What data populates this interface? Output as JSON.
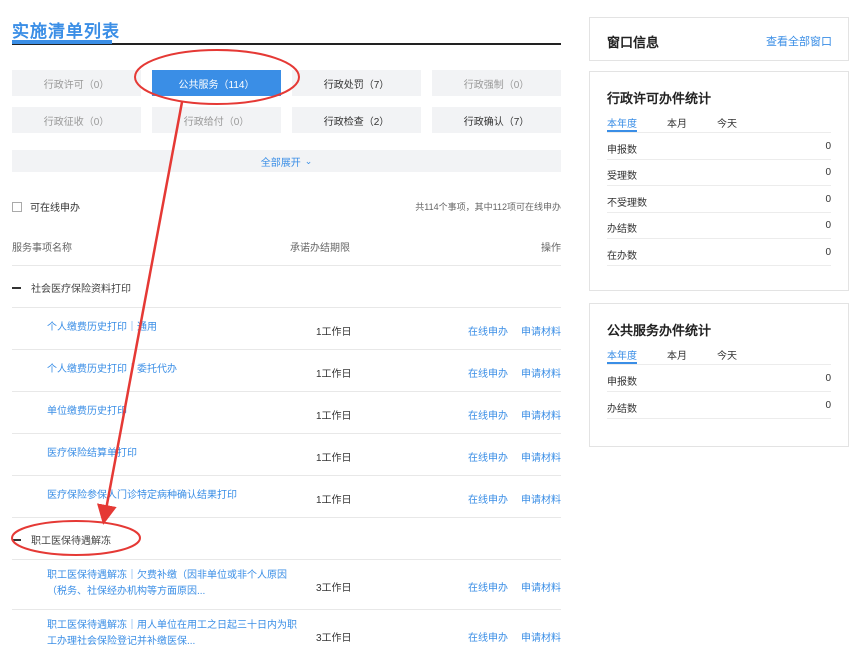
{
  "page_title": "实施清单列表",
  "categories": [
    {
      "label": "行政许可（0）"
    },
    {
      "label": "公共服务（114）"
    },
    {
      "label": "行政处罚（7）"
    },
    {
      "label": "行政强制（0）"
    },
    {
      "label": "行政征收（0）"
    },
    {
      "label": "行政给付（0）"
    },
    {
      "label": "行政检查（2）"
    },
    {
      "label": "行政确认（7）"
    }
  ],
  "expand_all": "全部展开",
  "online_filter_label": "可在线申办",
  "summary_text": "共114个事项，其中112项可在线申办",
  "table_headers": {
    "name": "服务事项名称",
    "deadline": "承诺办结期限",
    "operation": "操作"
  },
  "groups": [
    {
      "title": "社会医疗保险资料打印",
      "items": [
        {
          "name": "个人缴费历史打印｜通用",
          "days": "1工作日",
          "online": "在线申办",
          "materials": "申请材料"
        },
        {
          "name": "个人缴费历史打印｜委托代办",
          "days": "1工作日",
          "online": "在线申办",
          "materials": "申请材料"
        },
        {
          "name": "单位缴费历史打印",
          "days": "1工作日",
          "online": "在线申办",
          "materials": "申请材料"
        },
        {
          "name": "医疗保险结算单打印",
          "days": "1工作日",
          "online": "在线申办",
          "materials": "申请材料"
        },
        {
          "name": "医疗保险参保人门诊特定病种确认结果打印",
          "days": "1工作日",
          "online": "在线申办",
          "materials": "申请材料"
        }
      ]
    },
    {
      "title": "职工医保待遇解冻",
      "items": [
        {
          "name_line1": "职工医保待遇解冻｜欠费补缴（因非单位或非个人原因",
          "name_line2": "（税务、社保经办机构等方面原因...",
          "days": "3工作日",
          "online": "在线申办",
          "materials": "申请材料"
        },
        {
          "name_line1": "职工医保待遇解冻｜用人单位在用工之日起三十日内为职",
          "name_line2": "工办理社会保险登记并补缴医保...",
          "days": "3工作日",
          "online": "在线申办",
          "materials": "申请材料"
        }
      ]
    }
  ],
  "window_panel": {
    "title": "窗口信息",
    "link": "查看全部窗口"
  },
  "license_stats": {
    "title": "行政许可办件统计",
    "tabs": [
      "本年度",
      "本月",
      "今天"
    ],
    "rows": [
      {
        "label": "申报数",
        "value": "0"
      },
      {
        "label": "受理数",
        "value": "0"
      },
      {
        "label": "不受理数",
        "value": "0"
      },
      {
        "label": "办结数",
        "value": "0"
      },
      {
        "label": "在办数",
        "value": "0"
      }
    ]
  },
  "service_stats": {
    "title": "公共服务办件统计",
    "tabs": [
      "本年度",
      "本月",
      "今天"
    ],
    "rows": [
      {
        "label": "申报数",
        "value": "0"
      },
      {
        "label": "办结数",
        "value": "0"
      }
    ]
  },
  "colors": {
    "accent": "#3a8ee6",
    "annotation": "#e53935"
  },
  "icons": {
    "expand": "chevron-down-icon",
    "group_toggle": "minus-icon"
  }
}
